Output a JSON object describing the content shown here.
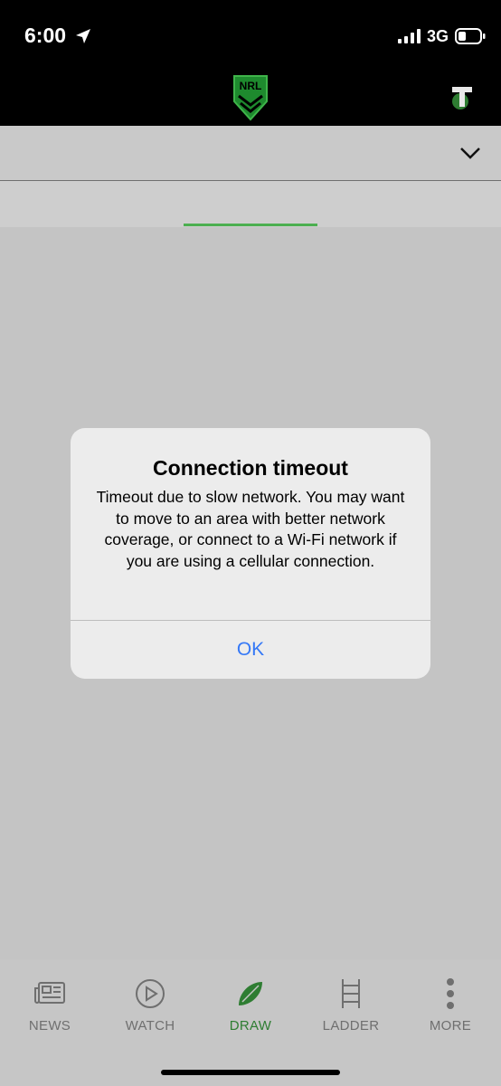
{
  "status": {
    "time": "6:00",
    "network": "3G"
  },
  "icons": {
    "location": "location-arrow-icon",
    "signal": "cellular-signal-icon",
    "battery": "battery-icon",
    "logo": "nrl-logo",
    "telstra": "telstra-logo",
    "chevron": "chevron-down-icon"
  },
  "dialog": {
    "title": "Connection timeout",
    "message": "Timeout due to slow network. You may want to move to an area with better network coverage, or connect to a Wi-Fi network if you are using a cellular connection.",
    "ok_label": "OK"
  },
  "tabbar": {
    "items": [
      {
        "label": "NEWS",
        "icon": "news-icon"
      },
      {
        "label": "WATCH",
        "icon": "play-icon"
      },
      {
        "label": "DRAW",
        "icon": "football-icon",
        "active": true
      },
      {
        "label": "LADDER",
        "icon": "ladder-icon"
      },
      {
        "label": "MORE",
        "icon": "more-icon"
      }
    ]
  },
  "colors": {
    "accent_green": "#2e7d32",
    "tab_indicator": "#4caf50",
    "ios_blue": "#3478f6"
  }
}
